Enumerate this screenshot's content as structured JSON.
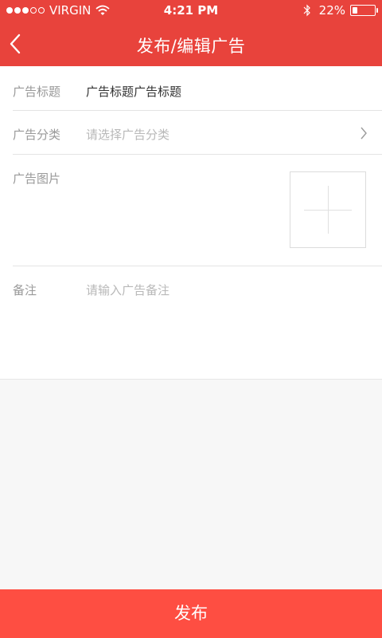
{
  "status_bar": {
    "carrier": "VIRGIN",
    "time": "4:21 PM",
    "battery_percent": "22%",
    "battery_level": 0.22,
    "signal_dots_filled": 3,
    "signal_dots_total": 5
  },
  "header": {
    "title": "发布/编辑广告",
    "back_icon": "chevron-left-icon",
    "color": "#e8433c"
  },
  "form": {
    "title_row": {
      "label": "广告标题",
      "value": "广告标题广告标题"
    },
    "category_row": {
      "label": "广告分类",
      "placeholder": "请选择广告分类",
      "icon": "chevron-right-icon"
    },
    "image_row": {
      "label": "广告图片",
      "upload_icon": "plus-icon"
    },
    "remark_row": {
      "label": "备注",
      "placeholder": "请输入广告备注"
    }
  },
  "submit": {
    "label": "发布",
    "color": "#fe4e42"
  }
}
